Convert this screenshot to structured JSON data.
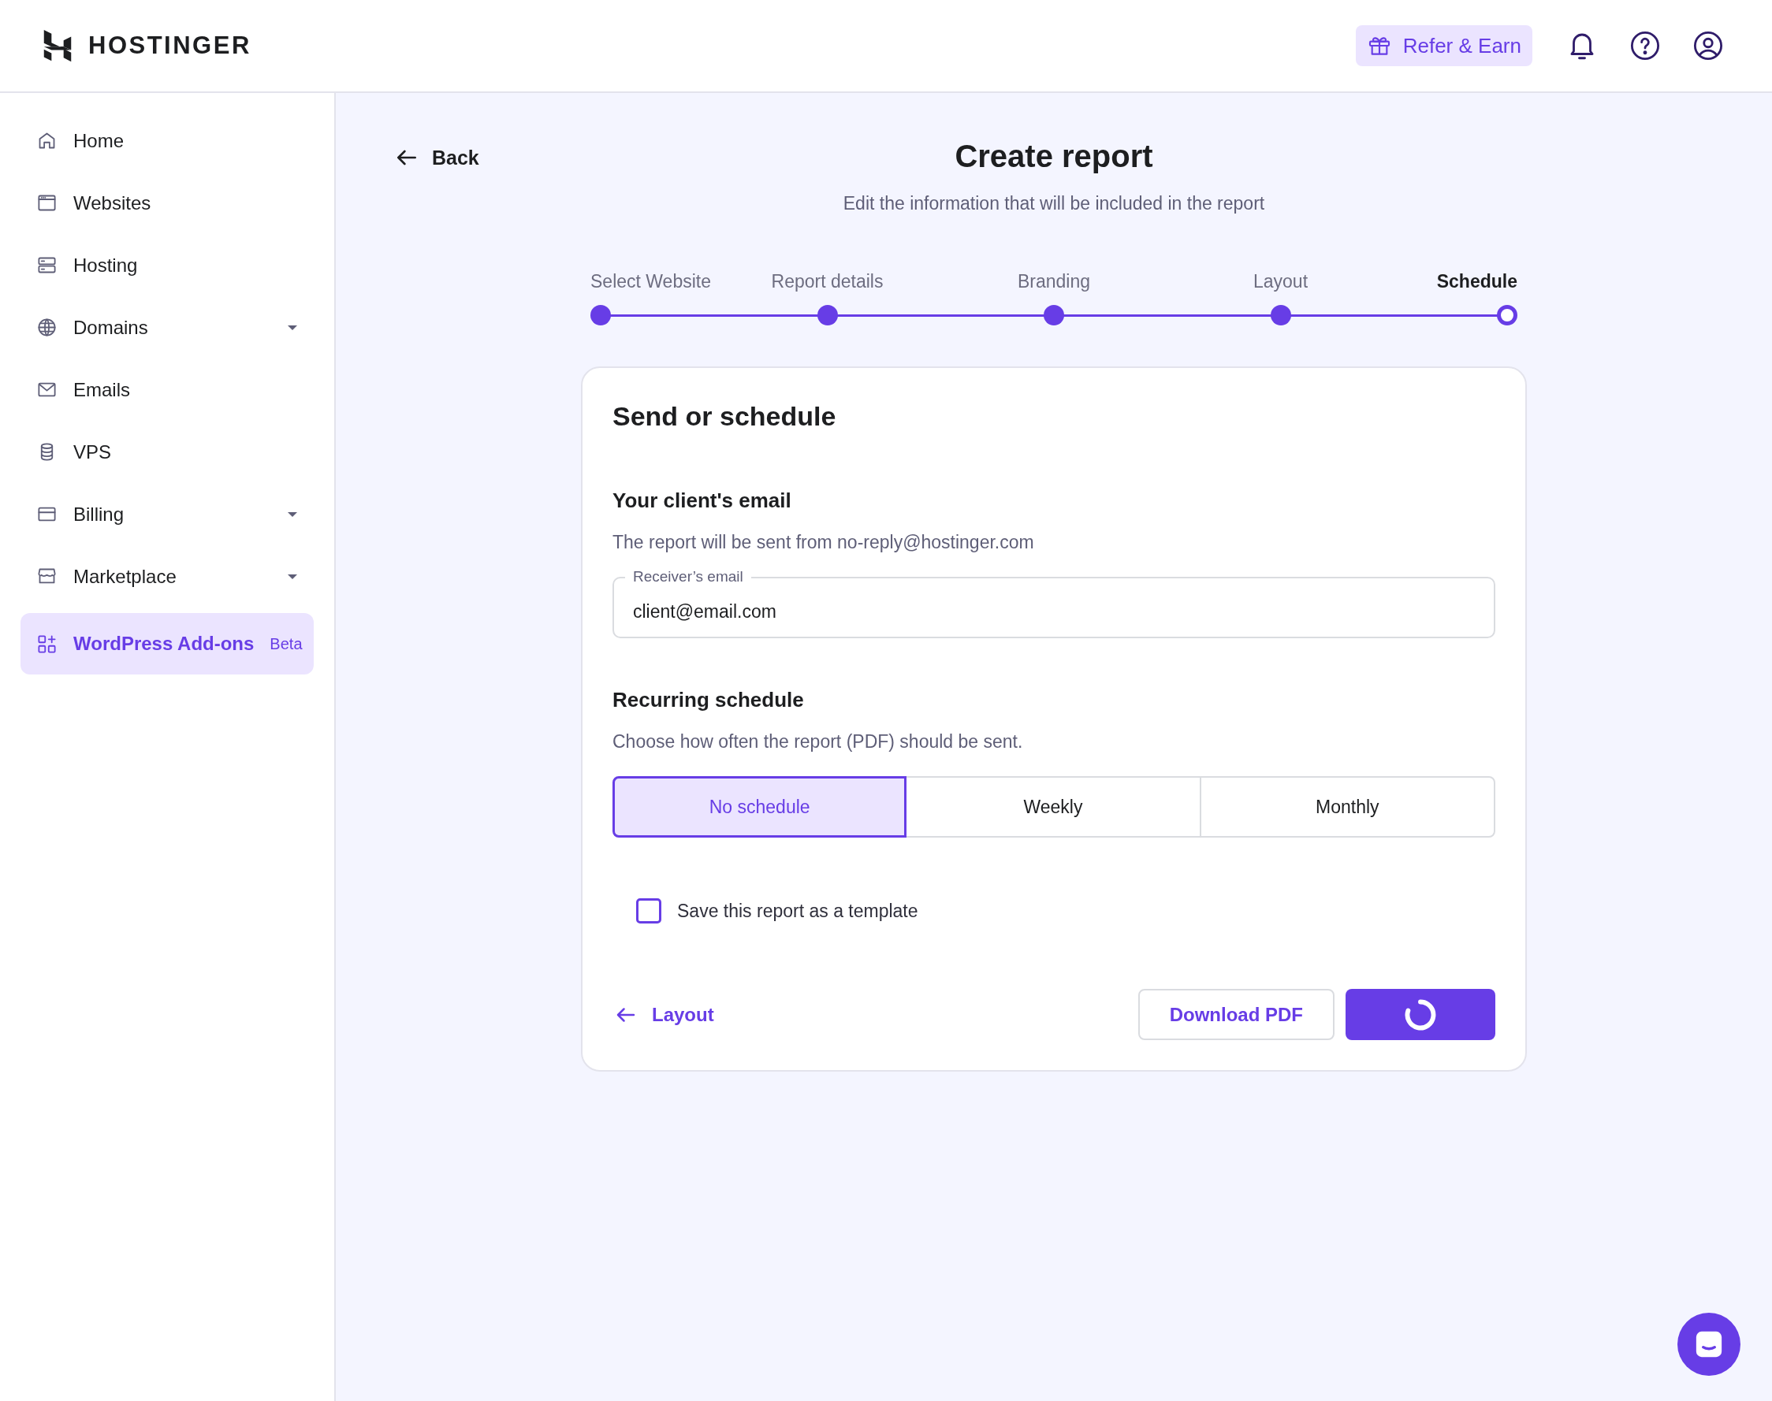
{
  "header": {
    "logo": "HOSTINGER",
    "refer_button": "Refer & Earn"
  },
  "sidebar": {
    "items": [
      {
        "label": "Home",
        "expandable": false,
        "selected": false
      },
      {
        "label": "Websites",
        "expandable": false,
        "selected": false
      },
      {
        "label": "Hosting",
        "expandable": false,
        "selected": false
      },
      {
        "label": "Domains",
        "expandable": true,
        "selected": false
      },
      {
        "label": "Emails",
        "expandable": false,
        "selected": false
      },
      {
        "label": "VPS",
        "expandable": false,
        "selected": false
      },
      {
        "label": "Billing",
        "expandable": true,
        "selected": false
      },
      {
        "label": "Marketplace",
        "expandable": true,
        "selected": false
      },
      {
        "label": "WordPress Add-ons",
        "badge": "Beta",
        "expandable": false,
        "selected": true
      }
    ]
  },
  "page": {
    "back": "Back",
    "title": "Create report",
    "subtitle": "Edit the information that will be included in the report"
  },
  "stepper": {
    "steps": [
      {
        "label": "Select Website",
        "completed": true,
        "selected": false
      },
      {
        "label": "Report details",
        "completed": true,
        "selected": false
      },
      {
        "label": "Branding",
        "completed": true,
        "selected": false
      },
      {
        "label": "Layout",
        "completed": true,
        "selected": false
      },
      {
        "label": "Schedule",
        "completed": false,
        "selected": true
      }
    ]
  },
  "card": {
    "title": "Send or schedule",
    "email_section": {
      "heading": "Your client's email",
      "description": "The report will be sent from no-reply@hostinger.com",
      "field_label": "Receiver’s email",
      "field_value": "client@email.com"
    },
    "schedule_section": {
      "heading": "Recurring schedule",
      "description": "Choose how often the report (PDF) should be sent.",
      "options": [
        {
          "label": "No schedule",
          "selected": true
        },
        {
          "label": "Weekly",
          "selected": false
        },
        {
          "label": "Monthly",
          "selected": false
        }
      ]
    },
    "template_checkbox": {
      "label": "Save this report as a template",
      "checked": false
    },
    "back_link": "Layout",
    "download_button": "Download PDF"
  }
}
